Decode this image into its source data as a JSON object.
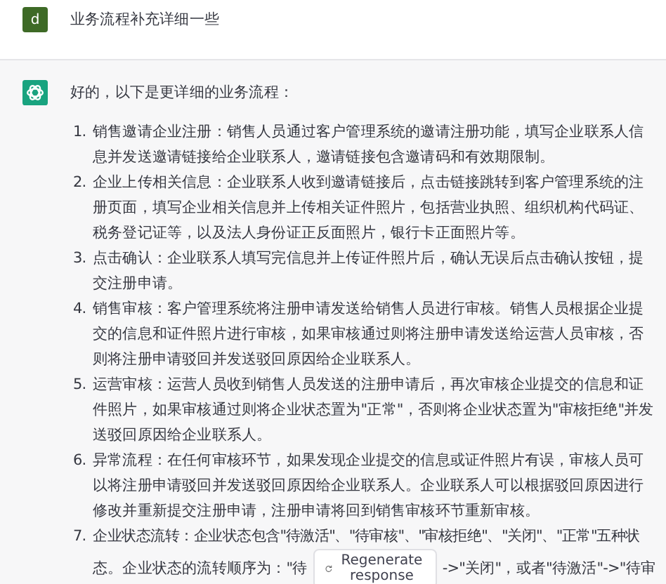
{
  "user_message": {
    "avatar": "d",
    "text": "业务流程补充详细一些"
  },
  "assistant_message": {
    "intro": "好的，以下是更详细的业务流程：",
    "items": [
      {
        "number": "1.",
        "text": "销售邀请企业注册：销售人员通过客户管理系统的邀请注册功能，填写企业联系人信息并发送邀请链接给企业联系人，邀请链接包含邀请码和有效期限制。"
      },
      {
        "number": "2.",
        "text": "企业上传相关信息：企业联系人收到邀请链接后，点击链接跳转到客户管理系统的注册页面，填写企业相关信息并上传相关证件照片，包括营业执照、组织机构代码证、税务登记证等，以及法人身份证正反面照片，银行卡正面照片等。"
      },
      {
        "number": "3.",
        "text": "点击确认：企业联系人填写完信息并上传证件照片后，确认无误后点击确认按钮，提交注册申请。"
      },
      {
        "number": "4.",
        "text": "销售审核：客户管理系统将注册申请发送给销售人员进行审核。销售人员根据企业提交的信息和证件照片进行审核，如果审核通过则将注册申请发送给运营人员审核，否则将注册申请驳回并发送驳回原因给企业联系人。"
      },
      {
        "number": "5.",
        "text": "运营审核：运营人员收到销售人员发送的注册申请后，再次审核企业提交的信息和证件照片，如果审核通过则将企业状态置为\"正常\"，否则将企业状态置为\"审核拒绝\"并发送驳回原因给企业联系人。"
      },
      {
        "number": "6.",
        "text": "异常流程：在任何审核环节，如果发现企业提交的信息或证件照片有误，审核人员可以将注册申请驳回并发送驳回原因给企业联系人。企业联系人可以根据驳回原因进行修改并重新提交注册申请，注册申请将回到销售审核环节重新审核。"
      },
      {
        "number": "7.",
        "text": "企业状态流转：企业状态包含\"待激活\"、\"待审核\"、\"审核拒绝\"、\"关闭\"、\"正常\"五种状",
        "lead": "态。企业状态的流转顺序为：\"待",
        "tail": "->\"关闭\"，或者\"待激活\"->\"待审"
      }
    ]
  },
  "regenerate_button": {
    "label": "Regenerate response"
  }
}
